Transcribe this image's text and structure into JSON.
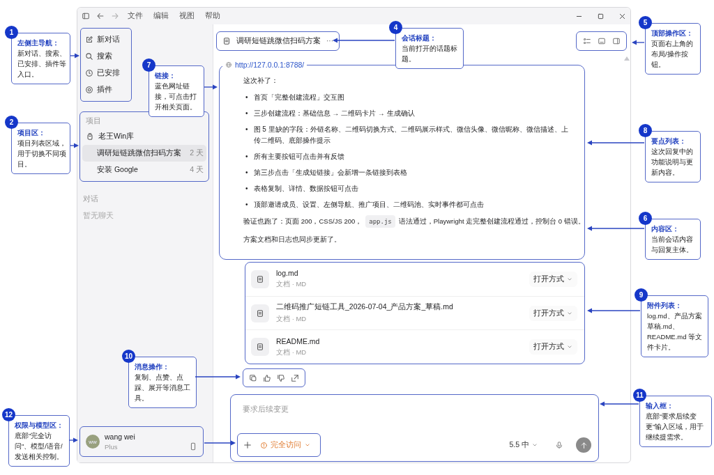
{
  "window": {
    "menus": [
      "文件",
      "编辑",
      "视图",
      "帮助"
    ]
  },
  "sidebar": {
    "nav_items": [
      "新对话",
      "搜索",
      "已安排",
      "插件"
    ],
    "projects": {
      "label": "项目",
      "items": [
        {
          "name": "老王Win库",
          "children": [
            {
              "name": "调研短链跳微信扫码方案",
              "age": "2 天",
              "selected": true
            },
            {
              "name": "安装 Google",
              "age": "4 天",
              "selected": false
            }
          ]
        }
      ]
    },
    "chats": {
      "label": "对话",
      "empty": "暂无聊天"
    },
    "user": {
      "initials": "ww",
      "name": "wang wei",
      "plan": "Plus"
    }
  },
  "chat": {
    "title": "调研短链跳微信扫码方案",
    "more": "···",
    "link": "http://127.0.0.1:8788/",
    "intro": "这次补了：",
    "bullet_marker": "•",
    "bullets": [
      "首页「完整创建流程」交互图",
      "三步创建流程：基础信息 → 二维码卡片 → 生成确认",
      "图 5 里缺的字段：外链名称、二维码切换方式、二维码展示样式、微信头像、微信昵称、微信描述、上传二维码、底部操作提示",
      "所有主要按钮可点击并有反馈",
      "第三步点击「生成短链接」会新增一条链接到表格",
      "表格复制、详情、数据按钮可点击",
      "顶部邀请成员、设置、左侧导航、推广项目、二维码池、实时事件都可点击"
    ],
    "verify": [
      {
        "kind": "text",
        "text": "验证也跑了：页面 200，CSS/JS 200，"
      },
      {
        "kind": "code",
        "text": "app.js"
      },
      {
        "kind": "text",
        "text": "语法通过，Playwright 走完整创建流程通过，控制台 0 错误。"
      }
    ],
    "closing": "方案文档和日志也同步更新了。",
    "attachments": [
      {
        "name": "log.md",
        "meta": "文档 · MD",
        "action": "打开方式"
      },
      {
        "name": "二维码推广短链工具_2026-07-04_产品方案_草稿.md",
        "meta": "文档 · MD",
        "action": "打开方式"
      },
      {
        "name": "README.md",
        "meta": "文档 · MD",
        "action": "打开方式"
      }
    ]
  },
  "composer": {
    "placeholder": "要求后续变更",
    "access": "完全访问",
    "model": "5.5 中"
  },
  "annotations": [
    {
      "number": "1",
      "title": "左侧主导航：",
      "text": "新对话、搜索、已安排、插件等入口。"
    },
    {
      "number": "2",
      "title": "项目区：",
      "text": "项目列表区域，用于切换不同项目。"
    },
    {
      "number": "4",
      "title": "会话标题：",
      "text": "当前打开的话题标题。"
    },
    {
      "number": "5",
      "title": "顶部操作区：",
      "text": "页面右上角的布局/操作按钮。"
    },
    {
      "number": "6",
      "title": "内容区：",
      "text": "当前会话内容与回复主体。"
    },
    {
      "number": "7",
      "title": "链接：",
      "text": "蓝色网址链接，可点击打开相关页面。"
    },
    {
      "number": "8",
      "title": "要点列表：",
      "text": "这次回复中的功能说明与更新内容。"
    },
    {
      "number": "9",
      "title": "附件列表：",
      "text": "log.md、产品方案草稿.md、README.md 等文件卡片。"
    },
    {
      "number": "10",
      "title": "消息操作：",
      "text": "复制、点赞、点踩、展开等消息工具。"
    },
    {
      "number": "11",
      "title": "输入框：",
      "text": "底部“要求后续变更”输入区域，用于继续提需求。"
    },
    {
      "number": "12",
      "title": "权限与模型区：",
      "text": "底部\"完全访问\"、模型/语音/发送相关控制。"
    }
  ]
}
